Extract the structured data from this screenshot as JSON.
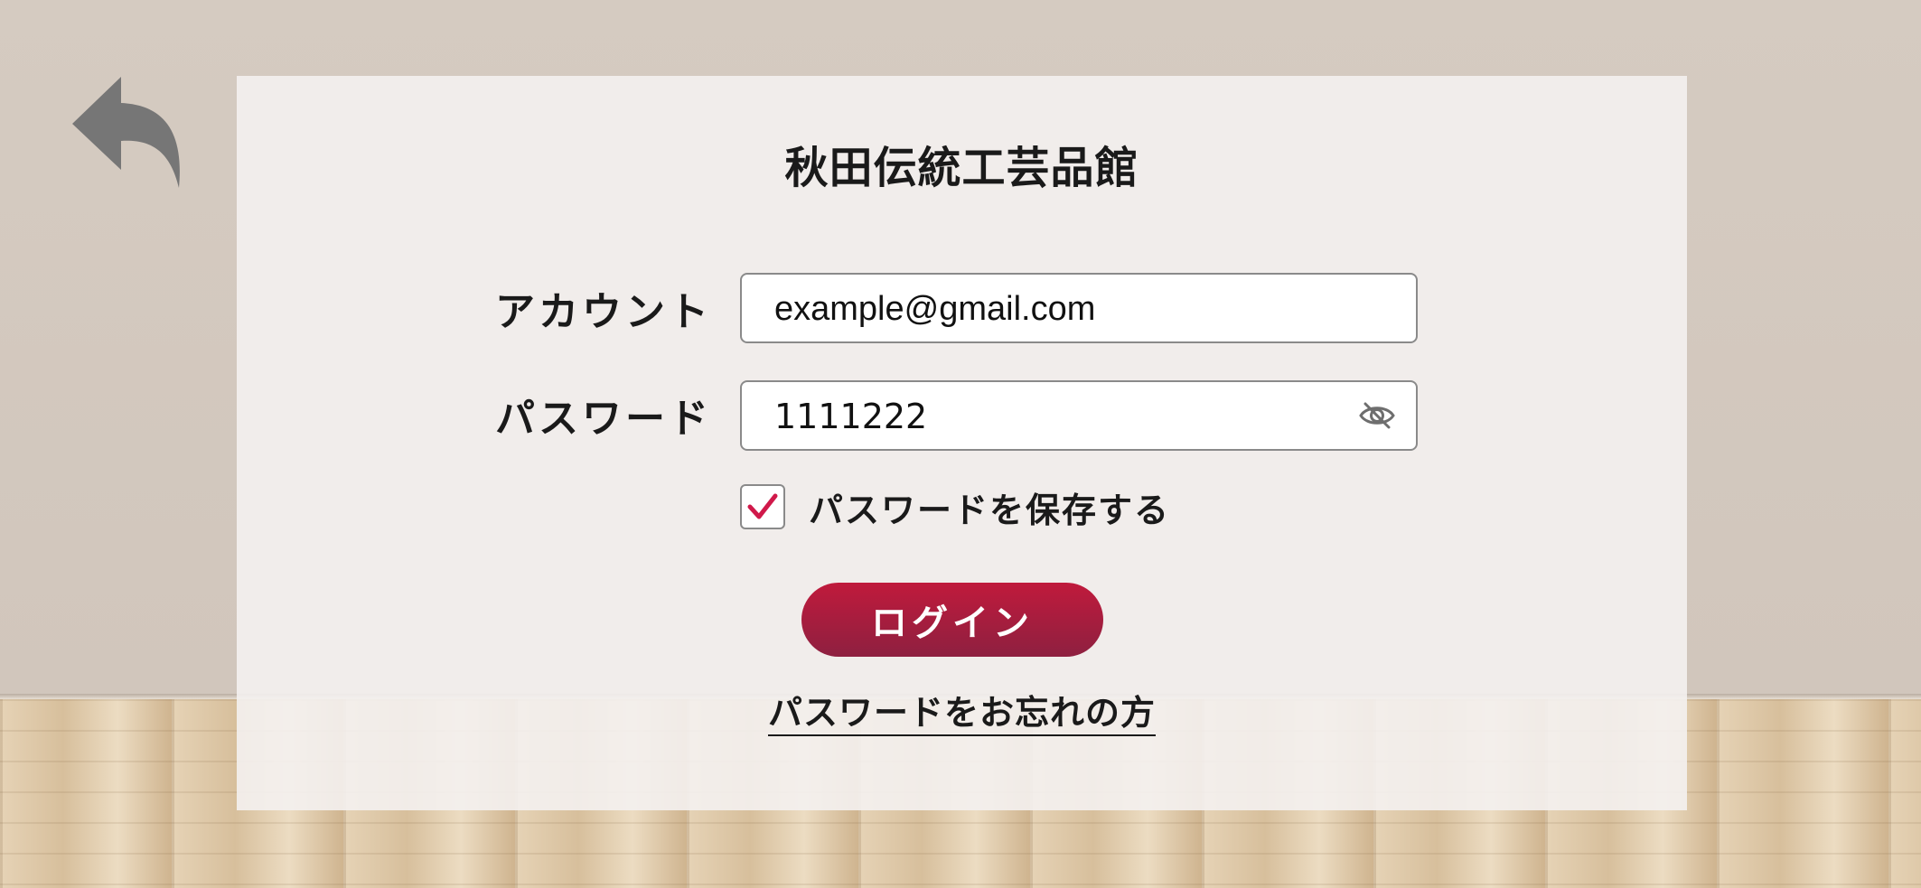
{
  "app": {
    "title": "秋田伝統工芸品館"
  },
  "form": {
    "account_label": "アカウント",
    "account_value": "example@gmail.com",
    "password_label": "パスワード",
    "password_value": "1111222",
    "password_visibility_icon": "eye-slash-icon",
    "remember_label": "パスワードを保存する",
    "remember_checked": true,
    "login_label": "ログイン",
    "forgot_label": "パスワードをお忘れの方"
  },
  "nav": {
    "back_icon": "back-arrow-icon"
  },
  "colors": {
    "accent": "#c01a3c",
    "accent_dark": "#8e2040",
    "back_icon": "#767676",
    "check": "#d0194a"
  }
}
